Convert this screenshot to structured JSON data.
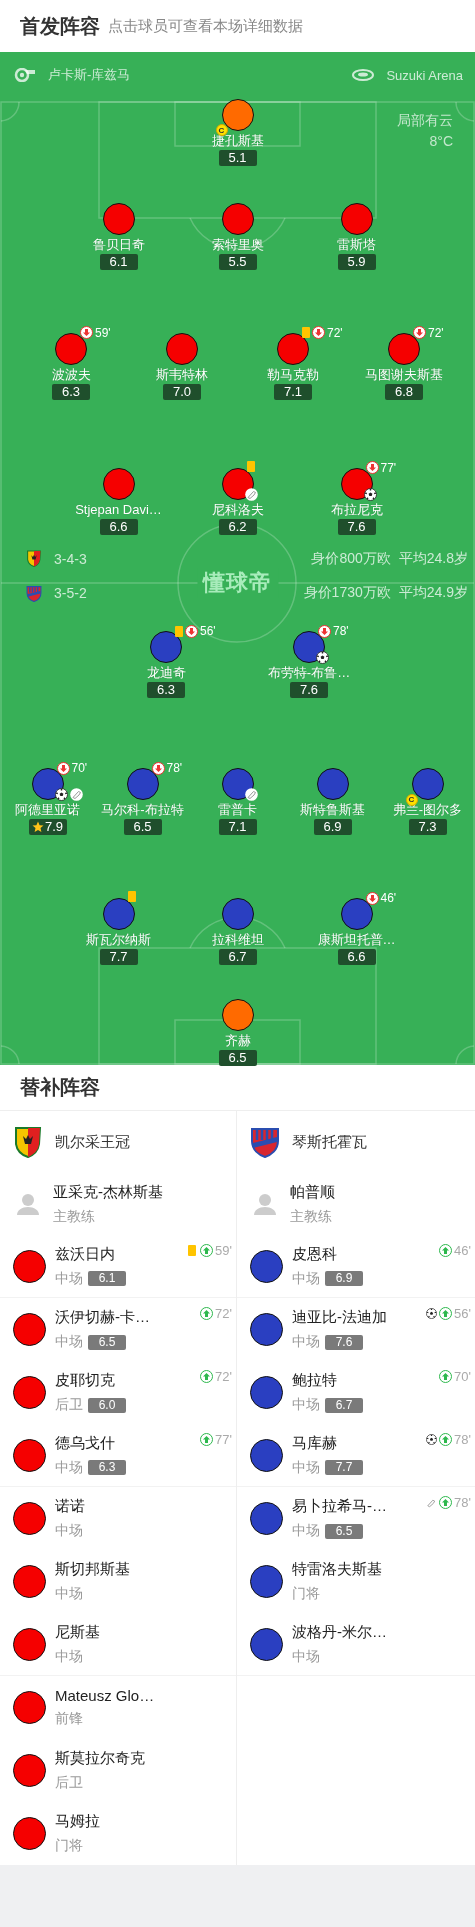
{
  "header": {
    "title": "首发阵容",
    "subtitle": "点击球员可查看本场详细数据"
  },
  "pitch": {
    "referee": "卢卡斯-库兹马",
    "venue": "Suzuki Arena",
    "weather": "局部有云",
    "temperature": "8°C",
    "logo_text": "懂球帝",
    "home": {
      "formation": "3-4-3",
      "value": "身价800万欧",
      "avg_age": "平均24.8岁",
      "lines": [
        {
          "players": [
            {
              "name": "捷孔斯基",
              "rating": "5.1",
              "color": "#ff6a00",
              "events": [
                {
                  "kind": "captain",
                  "label": "C"
                }
              ]
            }
          ]
        },
        {
          "players": [
            {
              "name": "鲁贝日奇",
              "rating": "6.1",
              "color": "#f50000"
            },
            {
              "name": "索特里奥",
              "rating": "5.5",
              "color": "#f50000"
            },
            {
              "name": "雷斯塔",
              "rating": "5.9",
              "color": "#f50000"
            }
          ]
        },
        {
          "players": [
            {
              "name": "波波夫",
              "rating": "6.3",
              "color": "#f50000",
              "events": [
                {
                  "kind": "sub_out",
                  "minute": "59'"
                }
              ]
            },
            {
              "name": "斯韦特林",
              "rating": "7.0",
              "color": "#f50000"
            },
            {
              "name": "勒马克勒",
              "rating": "7.1",
              "color": "#f50000",
              "events": [
                {
                  "kind": "yellow_card"
                },
                {
                  "kind": "sub_out",
                  "minute": "72'"
                }
              ]
            },
            {
              "name": "马图谢夫斯基",
              "rating": "6.8",
              "color": "#f50000",
              "events": [
                {
                  "kind": "sub_out",
                  "minute": "72'"
                }
              ]
            }
          ]
        },
        {
          "players": [
            {
              "name": "Stjepan Davi…",
              "rating": "6.6",
              "color": "#f50000"
            },
            {
              "name": "尼科洛夫",
              "rating": "6.2",
              "color": "#f50000",
              "events": [
                {
                  "kind": "yellow_card"
                },
                {
                  "kind": "assist"
                }
              ]
            },
            {
              "name": "布拉尼克",
              "rating": "7.6",
              "color": "#f50000",
              "events": [
                {
                  "kind": "sub_out",
                  "minute": "77'"
                },
                {
                  "kind": "goal"
                }
              ]
            }
          ]
        }
      ]
    },
    "away": {
      "formation": "3-5-2",
      "value": "身价1730万欧",
      "avg_age": "平均24.9岁",
      "lines": [
        {
          "players": [
            {
              "name": "龙迪奇",
              "rating": "6.3",
              "color": "#2a3fc1",
              "events": [
                {
                  "kind": "yellow_card"
                },
                {
                  "kind": "sub_out",
                  "minute": "56'"
                }
              ]
            },
            {
              "name": "布劳特-布鲁…",
              "rating": "7.6",
              "color": "#2a3fc1",
              "events": [
                {
                  "kind": "sub_out",
                  "minute": "78'"
                },
                {
                  "kind": "goal"
                }
              ]
            }
          ]
        },
        {
          "players": [
            {
              "name": "阿德里亚诺",
              "rating": "7.9",
              "color": "#2a3fc1",
              "events": [
                {
                  "kind": "mvp"
                },
                {
                  "kind": "sub_out",
                  "minute": "70'"
                },
                {
                  "kind": "goal"
                },
                {
                  "kind": "assist"
                }
              ]
            },
            {
              "name": "马尔科-布拉特",
              "rating": "6.5",
              "color": "#2a3fc1",
              "events": [
                {
                  "kind": "sub_out",
                  "minute": "78'"
                }
              ]
            },
            {
              "name": "雷普卡",
              "rating": "7.1",
              "color": "#2a3fc1",
              "events": [
                {
                  "kind": "assist"
                }
              ]
            },
            {
              "name": "斯特鲁斯基",
              "rating": "6.9",
              "color": "#2a3fc1"
            },
            {
              "name": "弗兰-图尔多",
              "rating": "7.3",
              "color": "#2a3fc1",
              "events": [
                {
                  "kind": "captain",
                  "label": "C"
                }
              ]
            }
          ]
        },
        {
          "players": [
            {
              "name": "斯瓦尔纳斯",
              "rating": "7.7",
              "color": "#2a3fc1",
              "events": [
                {
                  "kind": "yellow_card"
                }
              ]
            },
            {
              "name": "拉科维坦",
              "rating": "6.7",
              "color": "#2a3fc1"
            },
            {
              "name": "康斯坦托普…",
              "rating": "6.6",
              "color": "#2a3fc1",
              "events": [
                {
                  "kind": "sub_out",
                  "minute": "46'"
                }
              ]
            }
          ]
        },
        {
          "players": [
            {
              "name": "齐赫",
              "rating": "6.5",
              "color": "#ff6a00"
            }
          ]
        }
      ]
    }
  },
  "substitutes": {
    "title": "替补阵容",
    "teams": [
      {
        "name": "凯尔采王冠",
        "coach": {
          "name": "亚采克-杰林斯基",
          "role": "主教练"
        },
        "players": [
          {
            "name": "兹沃日内",
            "position": "中场",
            "rating": "6.1",
            "color": "#f50000",
            "events": [
              {
                "kind": "yellow_card"
              },
              {
                "kind": "sub_in",
                "minute": "59'"
              }
            ]
          },
          {
            "name": "沃伊切赫-卡…",
            "position": "中场",
            "rating": "6.5",
            "color": "#f50000",
            "events": [
              {
                "kind": "sub_in",
                "minute": "72'"
              }
            ]
          },
          {
            "name": "皮耶切克",
            "position": "后卫",
            "rating": "6.0",
            "color": "#f50000",
            "events": [
              {
                "kind": "sub_in",
                "minute": "72'"
              }
            ]
          },
          {
            "name": "德乌戈什",
            "position": "中场",
            "rating": "6.3",
            "color": "#f50000",
            "events": [
              {
                "kind": "sub_in",
                "minute": "77'"
              }
            ]
          },
          {
            "name": "诺诺",
            "position": "中场",
            "color": "#f50000"
          },
          {
            "name": "斯切邦斯基",
            "position": "中场",
            "color": "#f50000"
          },
          {
            "name": "尼斯基",
            "position": "中场",
            "color": "#f50000"
          },
          {
            "name": "Mateusz Glo…",
            "position": "前锋",
            "color": "#f50000"
          },
          {
            "name": "斯莫拉尔奇克",
            "position": "后卫",
            "color": "#f50000"
          },
          {
            "name": "马姆拉",
            "position": "门将",
            "color": "#f50000"
          }
        ]
      },
      {
        "name": "琴斯托霍瓦",
        "coach": {
          "name": "帕普顺",
          "role": "主教练"
        },
        "players": [
          {
            "name": "皮恩科",
            "position": "中场",
            "rating": "6.9",
            "color": "#2a3fc1",
            "events": [
              {
                "kind": "sub_in",
                "minute": "46'"
              }
            ]
          },
          {
            "name": "迪亚比-法迪加",
            "position": "中场",
            "rating": "7.6",
            "color": "#2a3fc1",
            "events": [
              {
                "kind": "goal"
              },
              {
                "kind": "sub_in",
                "minute": "56'"
              }
            ]
          },
          {
            "name": "鲍拉特",
            "position": "中场",
            "rating": "6.7",
            "color": "#2a3fc1",
            "events": [
              {
                "kind": "sub_in",
                "minute": "70'"
              }
            ]
          },
          {
            "name": "马库赫",
            "position": "中场",
            "rating": "7.7",
            "color": "#2a3fc1",
            "events": [
              {
                "kind": "goal"
              },
              {
                "kind": "sub_in",
                "minute": "78'"
              }
            ]
          },
          {
            "name": "易卜拉希马-…",
            "position": "中场",
            "rating": "6.5",
            "color": "#2a3fc1",
            "events": [
              {
                "kind": "assist"
              },
              {
                "kind": "sub_in",
                "minute": "78'"
              }
            ]
          },
          {
            "name": "特雷洛夫斯基",
            "position": "门将",
            "color": "#2a3fc1"
          },
          {
            "name": "波格丹-米尔…",
            "position": "中场",
            "color": "#2a3fc1"
          }
        ]
      }
    ]
  }
}
